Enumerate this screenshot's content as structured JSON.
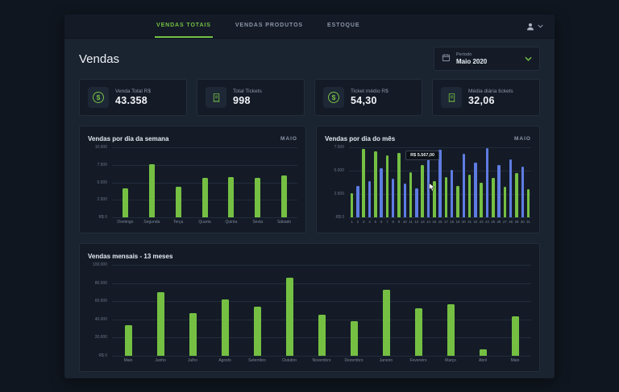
{
  "colors": {
    "accent_green": "#75c043",
    "bar_blue": "#5e7ce2"
  },
  "nav": {
    "tabs": [
      {
        "label": "VENDAS TOTAIS",
        "active": true
      },
      {
        "label": "VENDAS PRODUTOS",
        "active": false
      },
      {
        "label": "ESTOQUE",
        "active": false
      }
    ],
    "user_menu_icon": "user-icon"
  },
  "header": {
    "title": "Vendas",
    "period_label": "Período",
    "period_value": "Maio 2020"
  },
  "kpis": [
    {
      "icon": "dollar-icon",
      "label": "Venda Total R$",
      "value": "43.358"
    },
    {
      "icon": "receipt-icon",
      "label": "Total Tickets",
      "value": "998"
    },
    {
      "icon": "dollar-icon",
      "label": "Ticket médio R$",
      "value": "54,30"
    },
    {
      "icon": "receipt-icon",
      "label": "Média diária tickets",
      "value": "32,06"
    }
  ],
  "chart_data": [
    {
      "type": "bar",
      "title": "Vendas por dia da semana",
      "badge": "MAIO",
      "categories": [
        "Domingo",
        "Segunda",
        "Terça",
        "Quarta",
        "Quinta",
        "Sexta",
        "Sábado"
      ],
      "values": [
        4100,
        7600,
        4400,
        5600,
        5700,
        5600,
        6000
      ],
      "y_ticks": [
        "10.000",
        "7.500",
        "5.000",
        "2.500",
        "R$ 0"
      ],
      "ylim": [
        0,
        10000
      ],
      "bar_color": "green",
      "legend": "none",
      "grid": true
    },
    {
      "type": "bar",
      "title": "Vendas por dia do mês",
      "badge": "MAIO",
      "categories": [
        "1",
        "2",
        "3",
        "4",
        "5",
        "6",
        "7",
        "8",
        "9",
        "10",
        "11",
        "12",
        "13",
        "14",
        "15",
        "16",
        "17",
        "18",
        "19",
        "20",
        "21",
        "22",
        "23",
        "24",
        "25",
        "26",
        "27",
        "28",
        "29",
        "30",
        "31"
      ],
      "values": [
        2600,
        3400,
        7300,
        3900,
        7100,
        5300,
        6600,
        4100,
        6900,
        3600,
        4800,
        3100,
        5567,
        6400,
        3900,
        7200,
        4300,
        5100,
        3400,
        6800,
        4600,
        5900,
        3700,
        7400,
        4200,
        5600,
        3300,
        6200,
        4700,
        5400,
        3000
      ],
      "bar_colors": [
        "green",
        "blue",
        "green",
        "blue",
        "green",
        "blue",
        "green",
        "blue",
        "green",
        "blue",
        "green",
        "blue",
        "green",
        "blue",
        "green",
        "blue",
        "green",
        "blue",
        "green",
        "blue",
        "green",
        "blue",
        "green",
        "blue",
        "green",
        "blue",
        "green",
        "blue",
        "green",
        "blue",
        "green"
      ],
      "y_ticks": [
        "7.500",
        "5.000",
        "2.500",
        "R$ 0"
      ],
      "ylim": [
        0,
        7500
      ],
      "tooltip": {
        "text": "R$ 5.567,00",
        "index": 12
      },
      "legend": "none",
      "grid": true
    },
    {
      "type": "bar",
      "title": "Vendas mensais - 13 meses",
      "categories": [
        "Maio",
        "Junho",
        "Julho",
        "Agosto",
        "Setembro",
        "Outubro",
        "Novembro",
        "Dezembro",
        "Janeiro",
        "Fevereiro",
        "Março",
        "Abril",
        "Maio"
      ],
      "values": [
        34000,
        70000,
        47000,
        62000,
        54000,
        86000,
        45000,
        38000,
        73000,
        52000,
        57000,
        7000,
        43358
      ],
      "y_ticks": [
        "100.000",
        "80.000",
        "60.000",
        "40.000",
        "20.000",
        "R$ 0"
      ],
      "ylim": [
        0,
        100000
      ],
      "bar_color": "green",
      "legend": "none",
      "grid": true
    }
  ]
}
